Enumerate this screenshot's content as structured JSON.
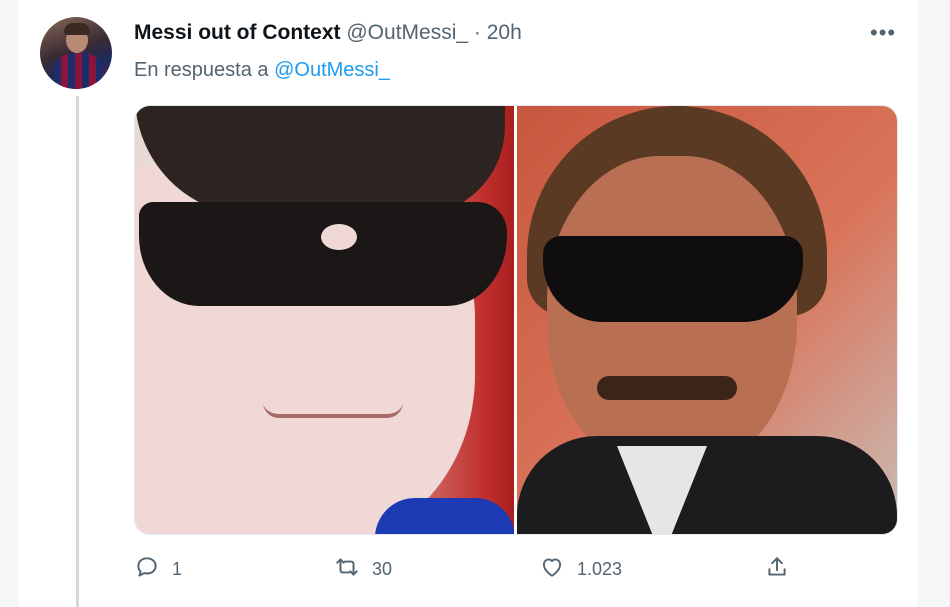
{
  "tweet": {
    "author_name": "Messi out of Context",
    "handle": "@OutMessi_",
    "separator": "·",
    "time": "20h",
    "more_label": "•••",
    "reply_prefix": "En respuesta a",
    "reply_mention": "@OutMessi_"
  },
  "actions": {
    "reply_count": "1",
    "retweet_count": "30",
    "like_count": "1.023"
  },
  "icons": {
    "reply": "comment-icon",
    "retweet": "retweet-icon",
    "like": "heart-icon",
    "share": "share-icon"
  },
  "colors": {
    "accent": "#1d9bf0",
    "muted": "#536471",
    "text": "#0f1419"
  }
}
